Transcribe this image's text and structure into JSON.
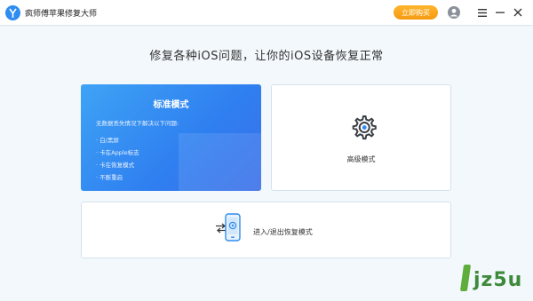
{
  "titlebar": {
    "app_title": "疯师傅苹果修复大师",
    "buy_label": "立即购买"
  },
  "main": {
    "headline": "修复各种iOS问题，让你的iOS设备恢复正常"
  },
  "standard_mode": {
    "title": "标准模式",
    "description": "无数据丢失情况下解决以下问题:",
    "items": [
      "· 白/黑屏",
      "· 卡在Apple标志",
      "· 卡在恢复模式",
      "· 不断重启"
    ]
  },
  "advanced_mode": {
    "label": "高级模式"
  },
  "recovery_mode": {
    "label": "进入/退出恢复模式"
  },
  "watermark": {
    "text": "jz5u"
  },
  "colors": {
    "accent": "#2f7ff0",
    "buy_button": "#f5a623",
    "background": "#f3f8fd"
  },
  "icons": [
    "app-logo-icon",
    "user-icon",
    "menu-icon",
    "minimize-icon",
    "close-icon",
    "gear-icon",
    "swap-arrows-icon",
    "phone-icon"
  ]
}
